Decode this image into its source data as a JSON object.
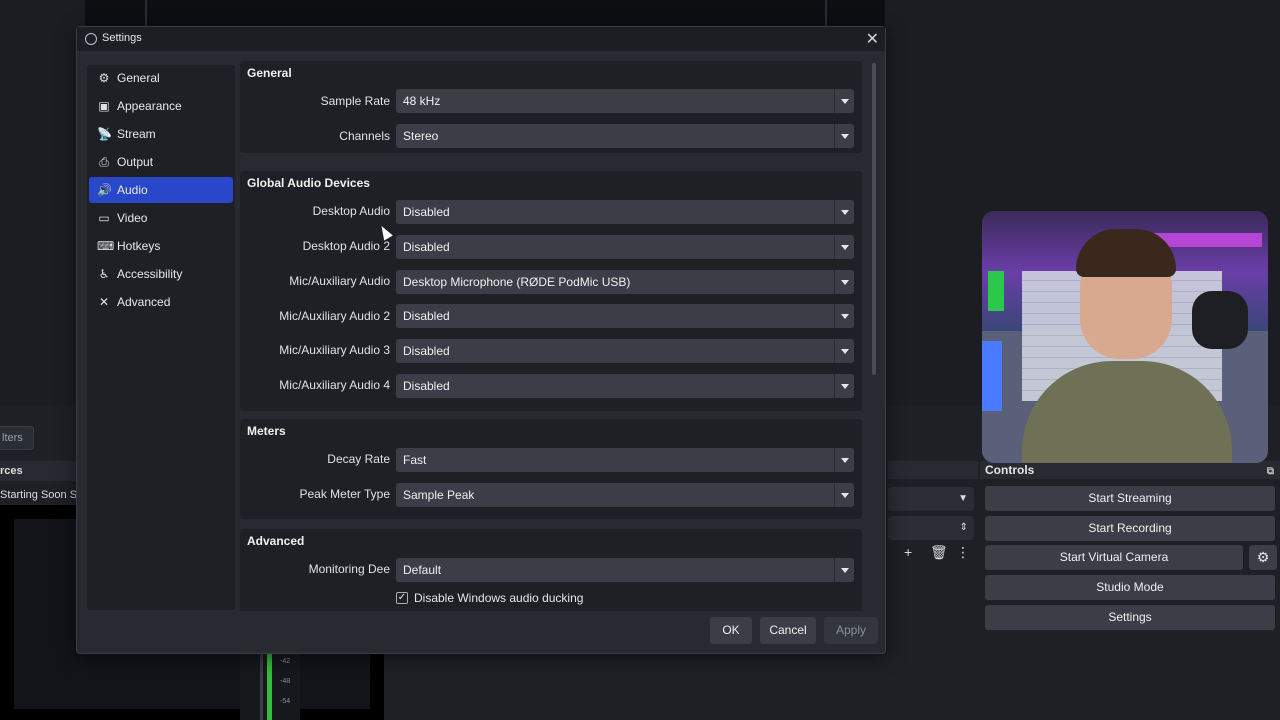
{
  "dialog": {
    "title": "Settings",
    "close_glyph": "✕",
    "buttons": {
      "ok": "OK",
      "cancel": "Cancel",
      "apply": "Apply"
    }
  },
  "sidebar": {
    "items": [
      {
        "label": "General",
        "icon": "gear-icon",
        "glyph": "⚙"
      },
      {
        "label": "Appearance",
        "icon": "appearance-icon",
        "glyph": "▣"
      },
      {
        "label": "Stream",
        "icon": "broadcast-icon",
        "glyph": "📡"
      },
      {
        "label": "Output",
        "icon": "output-icon",
        "glyph": "⎙"
      },
      {
        "label": "Audio",
        "icon": "speaker-icon",
        "glyph": "🔊"
      },
      {
        "label": "Video",
        "icon": "monitor-icon",
        "glyph": "▭"
      },
      {
        "label": "Hotkeys",
        "icon": "keyboard-icon",
        "glyph": "⌨"
      },
      {
        "label": "Accessibility",
        "icon": "accessibility-icon",
        "glyph": "♿"
      },
      {
        "label": "Advanced",
        "icon": "tools-icon",
        "glyph": "✕"
      }
    ],
    "active": "Audio"
  },
  "audio": {
    "general": {
      "title": "General",
      "sample_rate": {
        "label": "Sample Rate",
        "value": "48 kHz"
      },
      "channels": {
        "label": "Channels",
        "value": "Stereo"
      }
    },
    "global_devices": {
      "title": "Global Audio Devices",
      "rows": [
        {
          "label": "Desktop Audio",
          "value": "Disabled"
        },
        {
          "label": "Desktop Audio 2",
          "value": "Disabled"
        },
        {
          "label": "Mic/Auxiliary Audio",
          "value": "Desktop Microphone (RØDE PodMic USB)"
        },
        {
          "label": "Mic/Auxiliary Audio 2",
          "value": "Disabled"
        },
        {
          "label": "Mic/Auxiliary Audio 3",
          "value": "Disabled"
        },
        {
          "label": "Mic/Auxiliary Audio 4",
          "value": "Disabled"
        }
      ]
    },
    "meters": {
      "title": "Meters",
      "decay_rate": {
        "label": "Decay Rate",
        "value": "Fast"
      },
      "peak_meter_type": {
        "label": "Peak Meter Type",
        "value": "Sample Peak"
      }
    },
    "advanced": {
      "title": "Advanced",
      "monitoring_device": {
        "label": "Monitoring De",
        "label_tail": "e",
        "value": "Default"
      },
      "disable_ducking": {
        "label": "Disable Windows audio ducking",
        "checked": true
      }
    }
  },
  "background": {
    "filters_label": "lters",
    "sources_header": "rces",
    "sources_item": "Starting Soon Sc",
    "meter_ticks": [
      "-42",
      "-48",
      "-54"
    ],
    "controls": {
      "title": "Controls",
      "buttons": [
        "Start Streaming",
        "Start Recording",
        "Start Virtual Camera",
        "Studio Mode",
        "Settings"
      ]
    }
  },
  "colors": {
    "accent": "#2847c9",
    "dialog_bg": "#272a31",
    "panel_bg": "#1e2026",
    "combo_bg": "#3b3e46"
  }
}
